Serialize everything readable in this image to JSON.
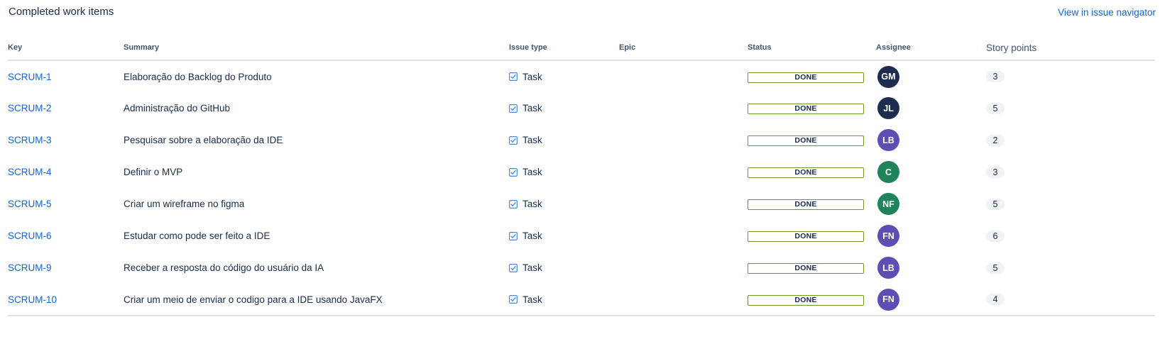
{
  "section": {
    "title": "Completed work items",
    "navigator_link": "View in issue navigator"
  },
  "columns": {
    "key": "Key",
    "summary": "Summary",
    "issue_type": "Issue type",
    "epic": "Epic",
    "status": "Status",
    "assignee": "Assignee",
    "story_points": "Story points"
  },
  "rows": [
    {
      "key": "SCRUM-1",
      "summary": "Elaboração do Backlog do Produto",
      "type": "Task",
      "epic": "",
      "status": "DONE",
      "assignee_initials": "GM",
      "avatar_color": "#1e2d4f",
      "points": "3"
    },
    {
      "key": "SCRUM-2",
      "summary": "Administração do GitHub",
      "type": "Task",
      "epic": "",
      "status": "DONE",
      "assignee_initials": "JL",
      "avatar_color": "#1e2d4f",
      "points": "5"
    },
    {
      "key": "SCRUM-3",
      "summary": "Pesquisar sobre a elaboração da IDE",
      "type": "Task",
      "epic": "",
      "status": "DONE",
      "assignee_initials": "LB",
      "avatar_color": "#5e4db2",
      "points": "2"
    },
    {
      "key": "SCRUM-4",
      "summary": "Definir o MVP",
      "type": "Task",
      "epic": "",
      "status": "DONE",
      "assignee_initials": "C",
      "avatar_color": "#1f845a",
      "points": "3"
    },
    {
      "key": "SCRUM-5",
      "summary": "Criar um wireframe no figma",
      "type": "Task",
      "epic": "",
      "status": "DONE",
      "assignee_initials": "NF",
      "avatar_color": "#1f845a",
      "points": "5"
    },
    {
      "key": "SCRUM-6",
      "summary": "Estudar como pode ser feito a IDE",
      "type": "Task",
      "epic": "",
      "status": "DONE",
      "assignee_initials": "FN",
      "avatar_color": "#5e4db2",
      "points": "6"
    },
    {
      "key": "SCRUM-9",
      "summary": "Receber a resposta do código do usuário da IA",
      "type": "Task",
      "epic": "",
      "status": "DONE",
      "assignee_initials": "LB",
      "avatar_color": "#5e4db2",
      "points": "5"
    },
    {
      "key": "SCRUM-10",
      "summary": "Criar um meio de enviar o codigo para a IDE usando JavaFX",
      "type": "Task",
      "epic": "",
      "status": "DONE",
      "assignee_initials": "FN",
      "avatar_color": "#5e4db2",
      "points": "4"
    }
  ],
  "icons": {
    "task": "checkbox-task-icon"
  },
  "colors": {
    "link": "#0c66e4",
    "done_border": "#6a9a23",
    "task_icon": "#4688ec"
  }
}
